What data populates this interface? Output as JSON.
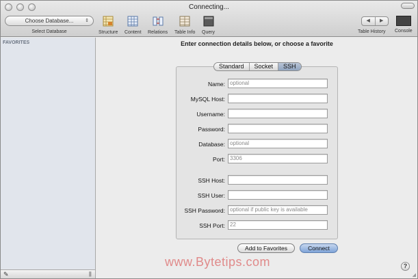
{
  "window": {
    "title": "Connecting..."
  },
  "toolbar": {
    "database_select": {
      "value": "Choose Database...",
      "label": "Select Database"
    },
    "items": [
      {
        "name": "structure",
        "label": "Structure",
        "icon": "structure-icon"
      },
      {
        "name": "content",
        "label": "Content",
        "icon": "content-icon"
      },
      {
        "name": "relations",
        "label": "Relations",
        "icon": "relations-icon"
      },
      {
        "name": "table-info",
        "label": "Table Info",
        "icon": "table-info-icon"
      },
      {
        "name": "query",
        "label": "Query",
        "icon": "query-icon"
      }
    ],
    "history": {
      "back": "◀",
      "forward": "▶",
      "label": "Table History"
    },
    "console": {
      "label": "Console"
    }
  },
  "sidebar": {
    "heading": "FAVORITES",
    "footer_icon": "pencil-icon"
  },
  "main": {
    "heading": "Enter connection details below, or choose a favorite",
    "tabs": [
      {
        "label": "Standard",
        "active": false
      },
      {
        "label": "Socket",
        "active": false
      },
      {
        "label": "SSH",
        "active": true
      }
    ],
    "fields": {
      "name": {
        "label": "Name:",
        "value": "",
        "placeholder": "optional"
      },
      "mysql_host": {
        "label": "MySQL Host:",
        "value": "",
        "placeholder": ""
      },
      "username": {
        "label": "Username:",
        "value": "",
        "placeholder": ""
      },
      "password": {
        "label": "Password:",
        "value": "",
        "placeholder": ""
      },
      "database": {
        "label": "Database:",
        "value": "",
        "placeholder": "optional"
      },
      "port": {
        "label": "Port:",
        "value": "",
        "placeholder": "3306"
      },
      "ssh_host": {
        "label": "SSH Host:",
        "value": "",
        "placeholder": ""
      },
      "ssh_user": {
        "label": "SSH User:",
        "value": "",
        "placeholder": ""
      },
      "ssh_password": {
        "label": "SSH Password:",
        "value": "",
        "placeholder": "optional if public key is available"
      },
      "ssh_port": {
        "label": "SSH Port:",
        "value": "",
        "placeholder": "22"
      }
    },
    "buttons": {
      "add_favorite": "Add to Favorites",
      "connect": "Connect"
    },
    "watermark": "www.Bytetips.com",
    "help": "?"
  },
  "colors": {
    "sidebar_bg": "#e1e5ec",
    "window_bg": "#ececec",
    "connect_button": "#7fa4d8",
    "active_tab": "#9fb1c9",
    "watermark": "#e08a8a"
  }
}
